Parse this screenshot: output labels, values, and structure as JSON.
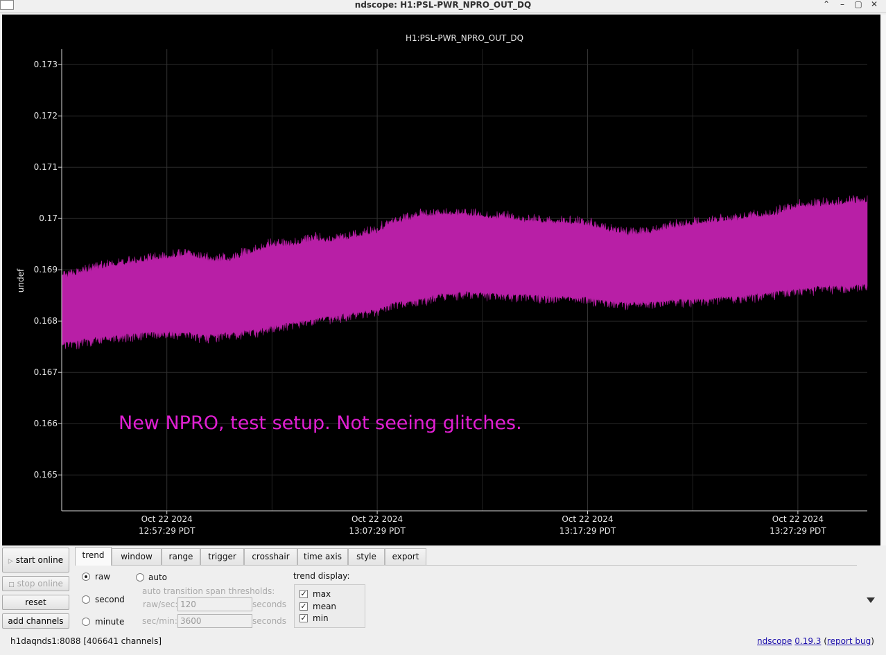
{
  "window": {
    "title": "ndscope: H1:PSL-PWR_NPRO_OUT_DQ",
    "buttons": [
      "⌃",
      "–",
      "▢",
      "✕"
    ]
  },
  "chart_data": {
    "type": "area",
    "title": "H1:PSL-PWR_NPRO_OUT_DQ",
    "xlabel": "",
    "ylabel": "undef",
    "ylim": [
      0.1643,
      0.1733
    ],
    "yticks": [
      "0.165",
      "0.166",
      "0.167",
      "0.168",
      "0.169",
      "0.17",
      "0.171",
      "0.172",
      "0.173"
    ],
    "ytick_values": [
      0.165,
      0.166,
      0.167,
      0.168,
      0.169,
      0.17,
      0.171,
      0.172,
      0.173
    ],
    "xlim_minutes": [
      -5,
      33.3
    ],
    "xticks": [
      {
        "minute": 0,
        "line1": "Oct 22 2024",
        "line2": "12:57:29 PDT"
      },
      {
        "minute": 10,
        "line1": "Oct 22 2024",
        "line2": "13:07:29 PDT"
      },
      {
        "minute": 20,
        "line1": "Oct 22 2024",
        "line2": "13:17:29 PDT"
      },
      {
        "minute": 30,
        "line1": "Oct 22 2024",
        "line2": "13:27:29 PDT"
      }
    ],
    "grid": true,
    "color": "#b81fa6",
    "series": [
      {
        "x": [
          -5,
          -3,
          -1,
          0,
          1,
          2,
          3,
          4,
          5,
          6,
          7,
          8,
          9,
          10,
          10.5,
          11,
          12,
          13,
          14,
          15,
          16,
          17,
          18,
          19,
          20,
          21,
          22,
          23,
          24,
          25,
          26,
          27,
          28,
          29,
          30,
          31,
          32,
          33.3
        ],
        "max": [
          0.1688,
          0.16902,
          0.16915,
          0.1692,
          0.16925,
          0.16915,
          0.16915,
          0.1693,
          0.16945,
          0.16945,
          0.16955,
          0.16952,
          0.16962,
          0.1697,
          0.16985,
          0.1699,
          0.17,
          0.17005,
          0.17005,
          0.17,
          0.16998,
          0.16992,
          0.1699,
          0.16988,
          0.16985,
          0.16972,
          0.16965,
          0.1697,
          0.16978,
          0.16985,
          0.1699,
          0.16995,
          0.17,
          0.17005,
          0.1702,
          0.17022,
          0.17025,
          0.1703
        ],
        "min": [
          0.1676,
          0.16772,
          0.1678,
          0.16782,
          0.1678,
          0.16775,
          0.1678,
          0.16785,
          0.16792,
          0.168,
          0.16808,
          0.16812,
          0.1682,
          0.16825,
          0.16835,
          0.1684,
          0.16845,
          0.16855,
          0.1686,
          0.16858,
          0.16855,
          0.16855,
          0.16852,
          0.1685,
          0.16848,
          0.16842,
          0.16838,
          0.1684,
          0.16843,
          0.16845,
          0.16848,
          0.1685,
          0.16855,
          0.1686,
          0.16865,
          0.1687,
          0.16872,
          0.16875
        ]
      }
    ],
    "annotation": "New NPRO, test setup. Not seeing glitches.",
    "annotation_color": "#e01fd2"
  },
  "controls": {
    "start_online": "start online",
    "stop_online": "stop online",
    "reset": "reset",
    "add_channels": "add channels"
  },
  "tabs": [
    "trend",
    "window",
    "range",
    "trigger",
    "crosshair",
    "time axis",
    "style",
    "export"
  ],
  "trend_tab": {
    "raw": "raw",
    "second": "second",
    "minute": "minute",
    "auto": "auto",
    "thresholds_label": "auto transition span thresholds:",
    "raw_sec_label": "raw/sec:",
    "raw_sec_value": "120",
    "sec_min_label": "sec/min:",
    "sec_min_value": "3600",
    "seconds1": "seconds",
    "seconds2": "seconds",
    "trend_display": "trend display:",
    "max": "max",
    "mean": "mean",
    "min": "min"
  },
  "status": {
    "server": "h1daqnds1:8088  [406641 channels]",
    "app": "ndscope",
    "version": "0.19.3",
    "report": "report bug"
  }
}
